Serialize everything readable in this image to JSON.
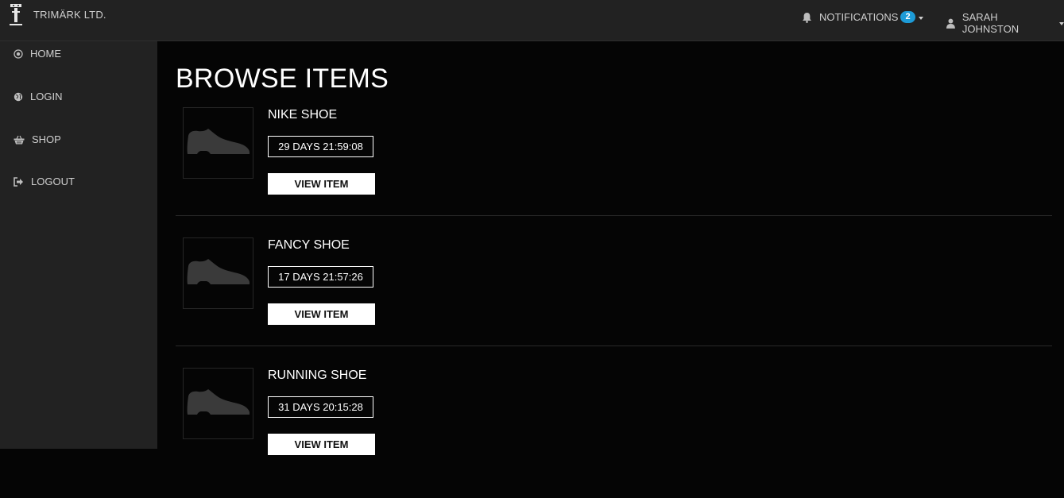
{
  "brand": {
    "name": "TRIMÄRK LTD."
  },
  "header": {
    "notifications_label": "NOTIFICATIONS",
    "notifications_count": "2",
    "user_name": "SARAH JOHNSTON"
  },
  "sidebar": {
    "items": [
      {
        "label": "HOME",
        "icon": "home-icon"
      },
      {
        "label": "LOGIN",
        "icon": "globe-icon"
      },
      {
        "label": "SHOP",
        "icon": "basket-icon"
      },
      {
        "label": "LOGOUT",
        "icon": "logout-icon"
      }
    ]
  },
  "main": {
    "title": "BROWSE ITEMS",
    "items": [
      {
        "name": "NIKE SHOE",
        "timer": "29 DAYS 21:59:08",
        "button": "VIEW ITEM"
      },
      {
        "name": "FANCY SHOE",
        "timer": "17 DAYS 21:57:26",
        "button": "VIEW ITEM"
      },
      {
        "name": "RUNNING SHOE",
        "timer": "31 DAYS 20:15:28",
        "button": "VIEW ITEM"
      }
    ]
  },
  "colors": {
    "background": "#050505",
    "sidebar": "#222222",
    "badge": "#1d9bd7",
    "text": "#cfcfcf"
  }
}
